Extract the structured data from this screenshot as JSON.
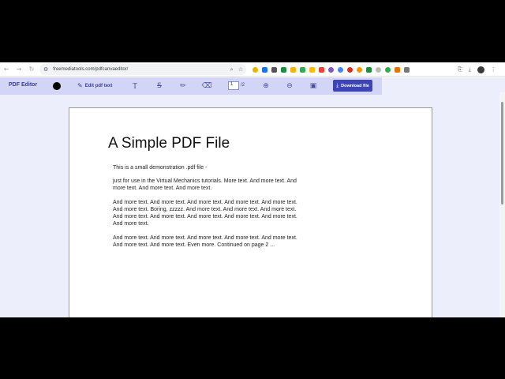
{
  "browser": {
    "url": "freemediatools.com/pdfcanvaeditor/"
  },
  "toolbar": {
    "app_title": "PDF Editor",
    "edit_text_label": "Edit pdf text",
    "current_page": "1",
    "total_pages": "/2",
    "download_label": "Download file"
  },
  "document": {
    "title": "A Simple PDF File",
    "paragraphs": [
      "This is a small demonstration .pdf file -",
      "just for use in the Virtual Mechanics tutorials. More text. And more text. And more text. And more text. And more text.",
      "And more text. And more text. And more text. And more text. And more text. And more text. Boring, zzzzz. And more text. And more text. And more text. And more text. And more text. And more text. And more text. And more text. And more text.",
      "And more text. And more text. And more text. And more text. And more text. And more text. And more text. Even more. Continued on page 2 ..."
    ]
  },
  "colors": {
    "toolbar_bg": "#d2d5f6",
    "page_bg": "#eceefb",
    "accent": "#3d44b5",
    "selected_color": "#000000"
  }
}
